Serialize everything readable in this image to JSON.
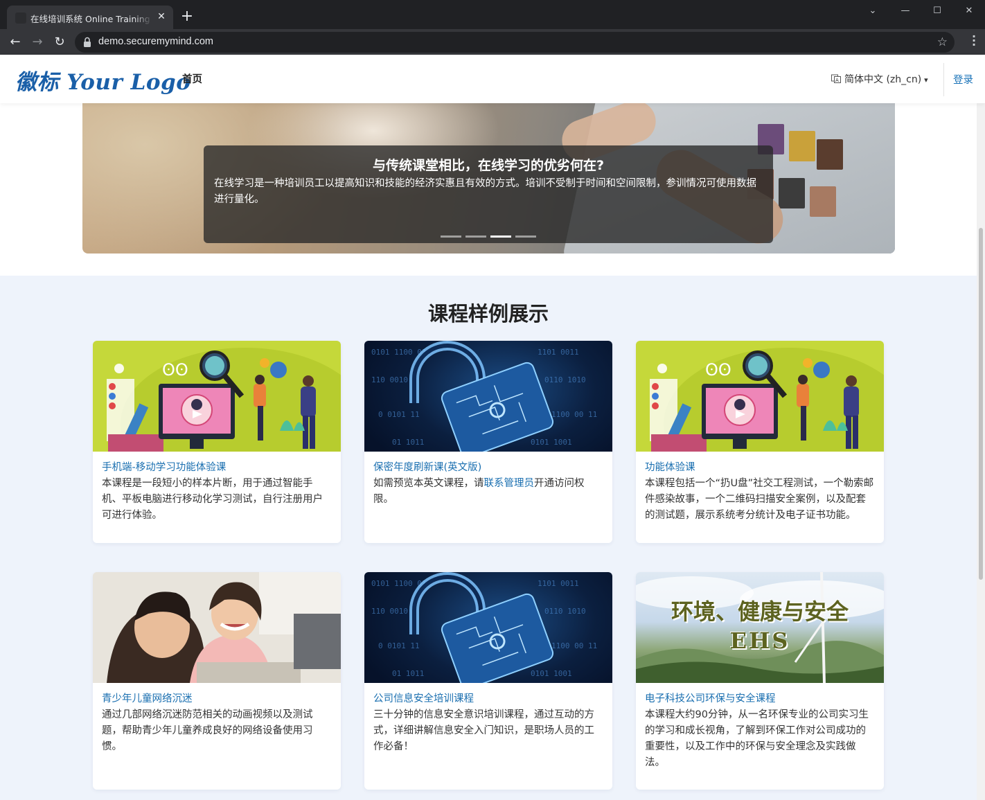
{
  "browser": {
    "tab_title": "在线培训系统 Online Training S",
    "url": "demo.securemymind.com"
  },
  "header": {
    "logo_text": "徽标 Your Logo",
    "nav_home": "首页",
    "language": "简体中文 (zh_cn)",
    "login": "登录"
  },
  "hero": {
    "title": "与传统课堂相比，在线学习的优劣何在?",
    "text": "在线学习是一种培训员工以提高知识和技能的经济实惠且有效的方式。培训不受制于时间和空间限制，参训情况可使用数据进行量化。",
    "indicator_count": 4,
    "active_indicator": 3
  },
  "courses": {
    "section_title": "课程样例展示",
    "items": [
      {
        "title": "手机端-移动学习功能体验课",
        "description": "本课程是一段短小的样本片断，用于通过智能手机、平板电脑进行移动化学习测试，自行注册用户可进行体验。",
        "image": "mobile-learning-illustration"
      },
      {
        "title": "保密年度刷新课(英文版)",
        "description_pre": "如需预览本英文课程，请",
        "description_link": "联系管理员",
        "description_post": "开通访问权限。",
        "image": "cyber-lock"
      },
      {
        "title": "功能体验课",
        "description": "本课程包括一个“扔U盘”社交工程测试，一个勒索邮件感染故事，一个二维码扫描安全案例，以及配套的测试题，展示系统考分统计及电子证书功能。",
        "image": "mobile-learning-illustration"
      },
      {
        "title": "青少年儿童网络沉迷",
        "description": "通过几部网络沉迷防范相关的动画视频以及测试题，帮助青少年儿童养成良好的网络设备使用习惯。",
        "image": "kids-photo"
      },
      {
        "title": "公司信息安全培训课程",
        "description": "三十分钟的信息安全意识培训课程，通过互动的方式，详细讲解信息安全入门知识，是职场人员的工作必备！",
        "image": "cyber-lock"
      },
      {
        "title": "电子科技公司环保与安全课程",
        "description": "本课程大约90分钟，从一名环保专业的公司实习生的学习和成长视角，了解到环保工作对公司成功的重要性，以及工作中的环保与安全理念及实践做法。",
        "image": "ehs-banner",
        "image_text_line1": "环境、健康与安全",
        "image_text_line2": "EHS"
      }
    ]
  },
  "colors": {
    "brand_blue": "#1a5fa8",
    "link_blue": "#1a6fb0",
    "section_bg": "#eef3fb",
    "thumb_green": "#c5d83a"
  }
}
